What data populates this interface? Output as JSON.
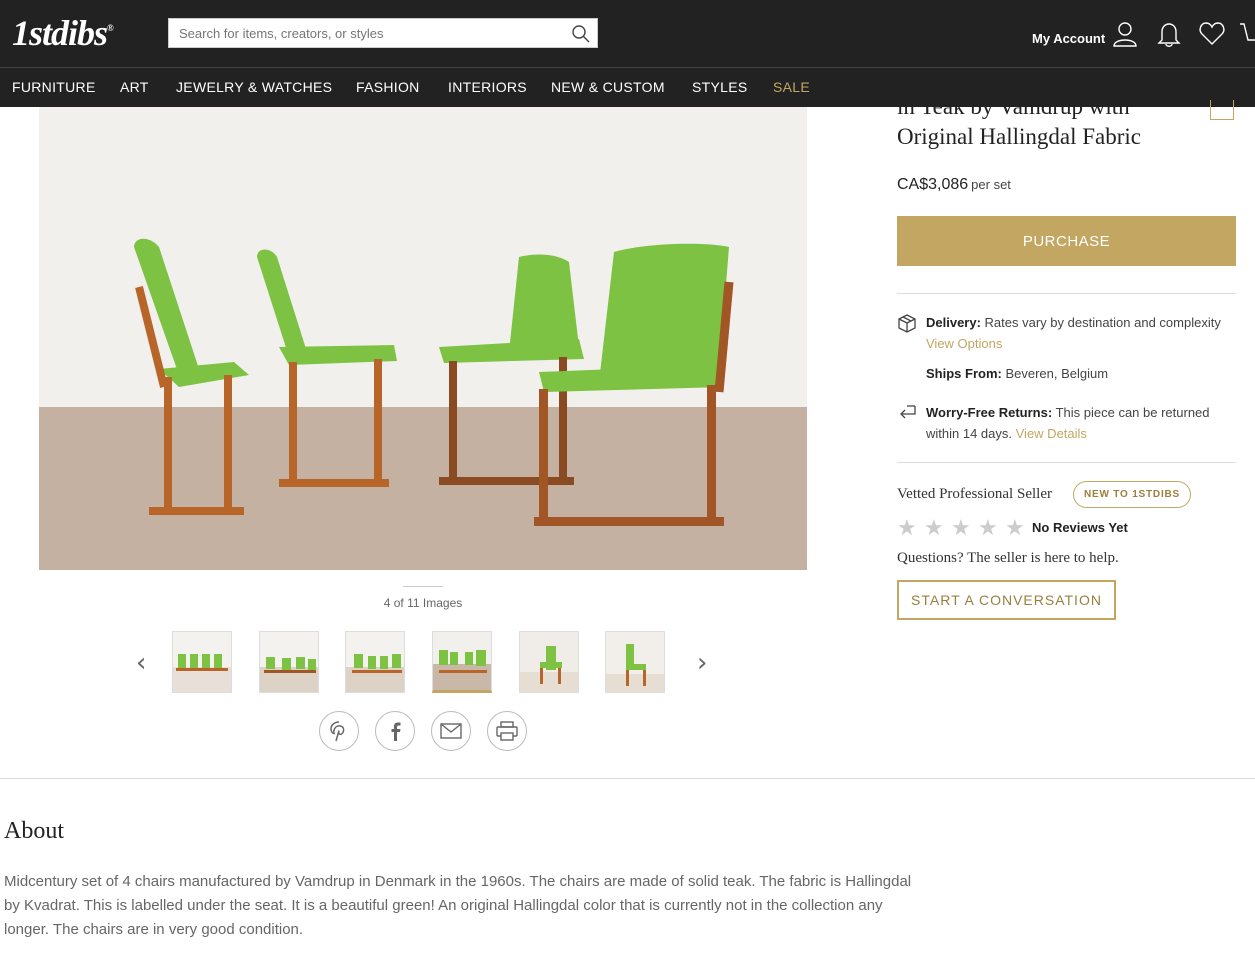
{
  "header": {
    "logo": "1stdibs",
    "logo_mark": "®",
    "search_placeholder": "Search for items, creators, or styles",
    "account_label": "My Account"
  },
  "nav": {
    "items": [
      "FURNITURE",
      "ART",
      "JEWELRY & WATCHES",
      "FASHION",
      "INTERIORS",
      "NEW & CUSTOM",
      "STYLES",
      "SALE"
    ]
  },
  "gallery": {
    "counter": "4 of 11 Images",
    "current_index": 4,
    "total": 11
  },
  "product": {
    "title_line1": "in Teak by Vamdrup with",
    "title_line2": "Original Hallingdal Fabric",
    "price": "CA$3,086",
    "price_unit": "per set",
    "purchase_label": "PURCHASE"
  },
  "shipping": {
    "delivery_label": "Delivery:",
    "delivery_text": "Rates vary by destination and complexity",
    "delivery_link": "View Options",
    "ships_from_label": "Ships From:",
    "ships_from_value": "Beveren, Belgium",
    "returns_label": "Worry-Free Returns:",
    "returns_text_1": "This piece can be returned",
    "returns_text_2": "within 14 days.",
    "returns_link": "View Details"
  },
  "seller": {
    "vetted": "Vetted Professional Seller",
    "badge": "NEW TO 1STDIBS",
    "rating": 0,
    "reviews": "No Reviews Yet",
    "questions": "Questions? The seller is here to help.",
    "conversation_button": "START A CONVERSATION"
  },
  "about": {
    "heading": "About",
    "line1": "Midcentury set of 4 chairs manufactured by Vamdrup in Denmark in the 1960s. The chairs are made of solid teak. The fabric is Hallingdal",
    "line2": "by Kvadrat. This is labelled under the seat. It is a beautiful green! An original Hallingdal color that is currently not in the collection any",
    "line3": "longer. The chairs are in very good condition."
  },
  "colors": {
    "header_bg": "#222222",
    "accent_gold": "#c2a661",
    "fabric_green": "#7dc243",
    "teak": "#b8652a"
  }
}
